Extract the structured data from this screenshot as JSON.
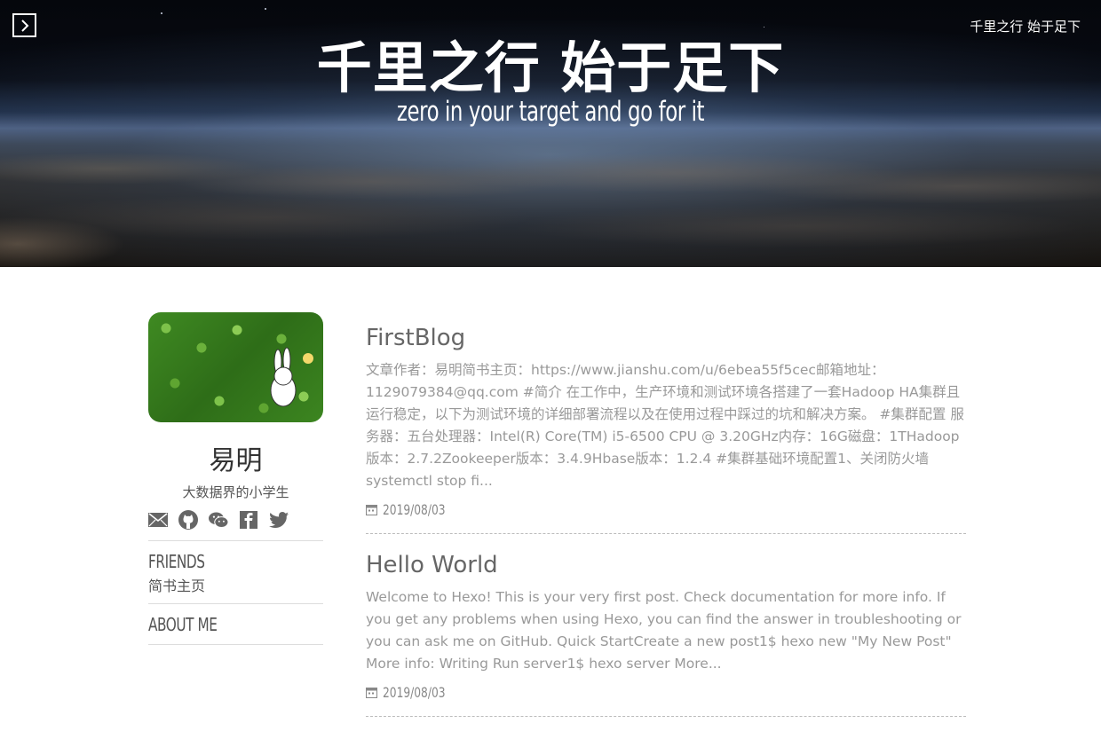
{
  "header": {
    "site_name": "千里之行 始于足下",
    "title": "千里之行 始于足下",
    "subtitle": "zero in your target and go for it"
  },
  "sidebar": {
    "author_name": "易明",
    "author_desc": "大数据界的小学生",
    "social_icons": [
      "mail-icon",
      "github-icon",
      "wechat-icon",
      "facebook-icon",
      "twitter-icon"
    ],
    "friends_heading": "FRIENDS",
    "friends_link": "简书主页",
    "about_heading": "ABOUT ME"
  },
  "posts": [
    {
      "title": "FirstBlog",
      "excerpt": "文章作者：易明简书主页：https://www.jianshu.com/u/6ebea55f5cec邮箱地址：1129079384@qq.com #简介 在工作中，生产环境和测试环境各搭建了一套Hadoop HA集群且运行稳定，以下为测试环境的详细部署流程以及在使用过程中踩过的坑和解决方案。 #集群配置 服务器：五台处理器：Intel(R) Core(TM) i5-6500 CPU @ 3.20GHz内存：16G磁盘：1THadoop版本：2.7.2Zookeeper版本：3.4.9Hbase版本：1.2.4 #集群基础环境配置1、关闭防火墙 systemctl stop fi...",
      "date": "2019/08/03"
    },
    {
      "title": "Hello World",
      "excerpt": "Welcome to Hexo! This is your very first post. Check documentation for more info. If you get any problems when using Hexo, you can find the answer in troubleshooting or you can ask me on GitHub. Quick StartCreate a new post1$ hexo new \"My New Post\" More info: Writing Run server1$ hexo server More...",
      "date": "2019/08/03"
    }
  ]
}
